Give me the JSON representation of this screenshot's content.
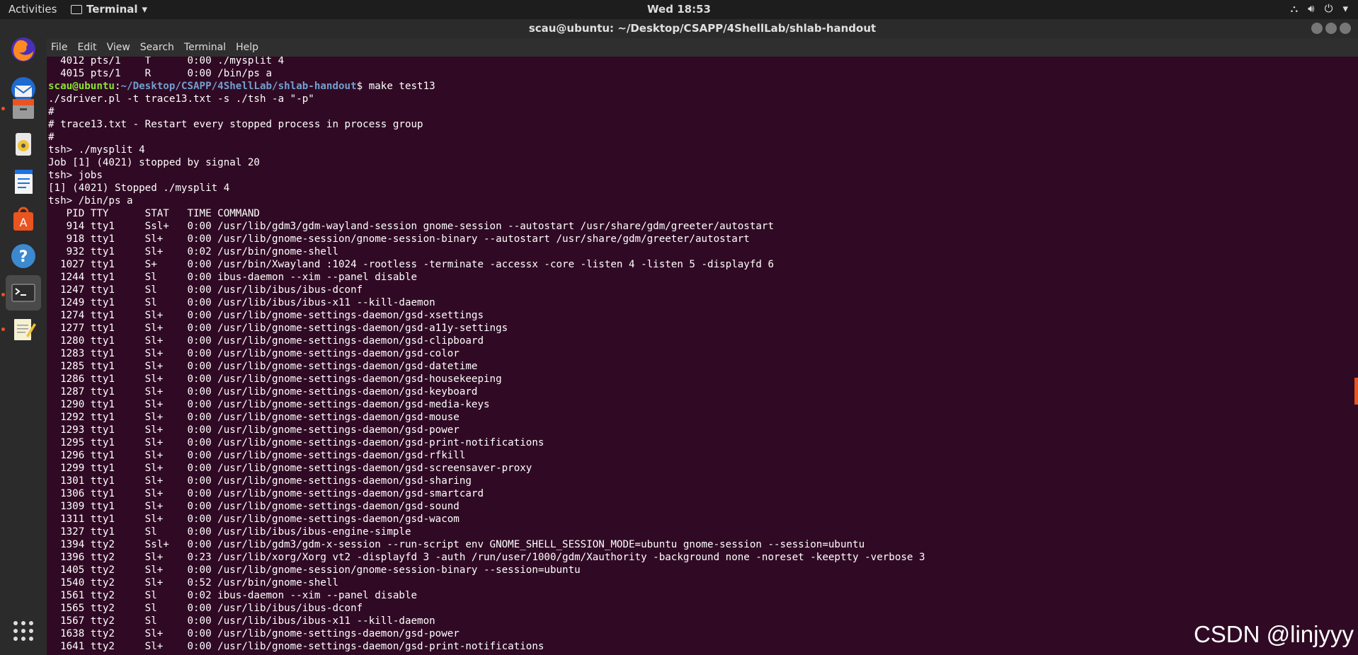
{
  "topbar": {
    "activities": "Activities",
    "app_menu": "Terminal",
    "clock": "Wed 18:53"
  },
  "window": {
    "title": "scau@ubuntu: ~/Desktop/CSAPP/4ShellLab/shlab-handout"
  },
  "menubar": [
    "File",
    "Edit",
    "View",
    "Search",
    "Terminal",
    "Help"
  ],
  "dock": [
    "firefox-icon",
    "thunderbird-icon",
    "files-icon",
    "rhythmbox-icon",
    "libreoffice-writer-icon",
    "software-center-icon",
    "help-icon",
    "terminal-icon",
    "text-editor-icon",
    "show-applications-icon"
  ],
  "prompt": {
    "user": "scau@ubuntu",
    "sep": ":",
    "path": "~/Desktop/CSAPP/4ShellLab/shlab-handout",
    "cmd": "$ make test13"
  },
  "terminal": {
    "top_lines": [
      "  4012 pts/1    T      0:00 ./mysplit 4",
      "  4015 pts/1    R      0:00 /bin/ps a"
    ],
    "lines": [
      "./sdriver.pl -t trace13.txt -s ./tsh -a \"-p\"",
      "#",
      "# trace13.txt - Restart every stopped process in process group",
      "#",
      "tsh> ./mysplit 4",
      "Job [1] (4021) stopped by signal 20",
      "tsh> jobs",
      "[1] (4021) Stopped ./mysplit 4",
      "tsh> /bin/ps a",
      "   PID TTY      STAT   TIME COMMAND",
      "   914 tty1     Ssl+   0:00 /usr/lib/gdm3/gdm-wayland-session gnome-session --autostart /usr/share/gdm/greeter/autostart",
      "   918 tty1     Sl+    0:00 /usr/lib/gnome-session/gnome-session-binary --autostart /usr/share/gdm/greeter/autostart",
      "   932 tty1     Sl+    0:02 /usr/bin/gnome-shell",
      "  1027 tty1     S+     0:00 /usr/bin/Xwayland :1024 -rootless -terminate -accessx -core -listen 4 -listen 5 -displayfd 6",
      "  1244 tty1     Sl     0:00 ibus-daemon --xim --panel disable",
      "  1247 tty1     Sl     0:00 /usr/lib/ibus/ibus-dconf",
      "  1249 tty1     Sl     0:00 /usr/lib/ibus/ibus-x11 --kill-daemon",
      "  1274 tty1     Sl+    0:00 /usr/lib/gnome-settings-daemon/gsd-xsettings",
      "  1277 tty1     Sl+    0:00 /usr/lib/gnome-settings-daemon/gsd-a11y-settings",
      "  1280 tty1     Sl+    0:00 /usr/lib/gnome-settings-daemon/gsd-clipboard",
      "  1283 tty1     Sl+    0:00 /usr/lib/gnome-settings-daemon/gsd-color",
      "  1285 tty1     Sl+    0:00 /usr/lib/gnome-settings-daemon/gsd-datetime",
      "  1286 tty1     Sl+    0:00 /usr/lib/gnome-settings-daemon/gsd-housekeeping",
      "  1287 tty1     Sl+    0:00 /usr/lib/gnome-settings-daemon/gsd-keyboard",
      "  1290 tty1     Sl+    0:00 /usr/lib/gnome-settings-daemon/gsd-media-keys",
      "  1292 tty1     Sl+    0:00 /usr/lib/gnome-settings-daemon/gsd-mouse",
      "  1293 tty1     Sl+    0:00 /usr/lib/gnome-settings-daemon/gsd-power",
      "  1295 tty1     Sl+    0:00 /usr/lib/gnome-settings-daemon/gsd-print-notifications",
      "  1296 tty1     Sl+    0:00 /usr/lib/gnome-settings-daemon/gsd-rfkill",
      "  1299 tty1     Sl+    0:00 /usr/lib/gnome-settings-daemon/gsd-screensaver-proxy",
      "  1301 tty1     Sl+    0:00 /usr/lib/gnome-settings-daemon/gsd-sharing",
      "  1306 tty1     Sl+    0:00 /usr/lib/gnome-settings-daemon/gsd-smartcard",
      "  1309 tty1     Sl+    0:00 /usr/lib/gnome-settings-daemon/gsd-sound",
      "  1311 tty1     Sl+    0:00 /usr/lib/gnome-settings-daemon/gsd-wacom",
      "  1327 tty1     Sl     0:00 /usr/lib/ibus/ibus-engine-simple",
      "  1394 tty2     Ssl+   0:00 /usr/lib/gdm3/gdm-x-session --run-script env GNOME_SHELL_SESSION_MODE=ubuntu gnome-session --session=ubuntu",
      "  1396 tty2     Sl+    0:23 /usr/lib/xorg/Xorg vt2 -displayfd 3 -auth /run/user/1000/gdm/Xauthority -background none -noreset -keeptty -verbose 3",
      "  1405 tty2     Sl+    0:00 /usr/lib/gnome-session/gnome-session-binary --session=ubuntu",
      "  1540 tty2     Sl+    0:52 /usr/bin/gnome-shell",
      "  1561 tty2     Sl     0:02 ibus-daemon --xim --panel disable",
      "  1565 tty2     Sl     0:00 /usr/lib/ibus/ibus-dconf",
      "  1567 tty2     Sl     0:00 /usr/lib/ibus/ibus-x11 --kill-daemon",
      "  1638 tty2     Sl+    0:00 /usr/lib/gnome-settings-daemon/gsd-power",
      "  1641 tty2     Sl+    0:00 /usr/lib/gnome-settings-daemon/gsd-print-notifications"
    ]
  },
  "watermark": "CSDN @linjyyy"
}
